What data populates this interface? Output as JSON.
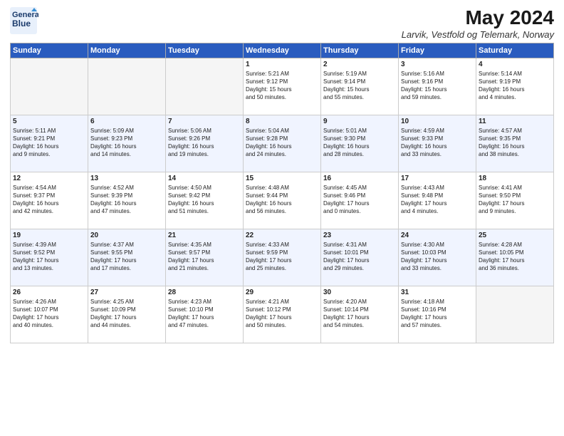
{
  "logo": {
    "line1": "General",
    "line2": "Blue"
  },
  "title": "May 2024",
  "location": "Larvik, Vestfold og Telemark, Norway",
  "days_of_week": [
    "Sunday",
    "Monday",
    "Tuesday",
    "Wednesday",
    "Thursday",
    "Friday",
    "Saturday"
  ],
  "weeks": [
    [
      {
        "day": "",
        "info": ""
      },
      {
        "day": "",
        "info": ""
      },
      {
        "day": "",
        "info": ""
      },
      {
        "day": "1",
        "info": "Sunrise: 5:21 AM\nSunset: 9:12 PM\nDaylight: 15 hours\nand 50 minutes."
      },
      {
        "day": "2",
        "info": "Sunrise: 5:19 AM\nSunset: 9:14 PM\nDaylight: 15 hours\nand 55 minutes."
      },
      {
        "day": "3",
        "info": "Sunrise: 5:16 AM\nSunset: 9:16 PM\nDaylight: 15 hours\nand 59 minutes."
      },
      {
        "day": "4",
        "info": "Sunrise: 5:14 AM\nSunset: 9:19 PM\nDaylight: 16 hours\nand 4 minutes."
      }
    ],
    [
      {
        "day": "5",
        "info": "Sunrise: 5:11 AM\nSunset: 9:21 PM\nDaylight: 16 hours\nand 9 minutes."
      },
      {
        "day": "6",
        "info": "Sunrise: 5:09 AM\nSunset: 9:23 PM\nDaylight: 16 hours\nand 14 minutes."
      },
      {
        "day": "7",
        "info": "Sunrise: 5:06 AM\nSunset: 9:26 PM\nDaylight: 16 hours\nand 19 minutes."
      },
      {
        "day": "8",
        "info": "Sunrise: 5:04 AM\nSunset: 9:28 PM\nDaylight: 16 hours\nand 24 minutes."
      },
      {
        "day": "9",
        "info": "Sunrise: 5:01 AM\nSunset: 9:30 PM\nDaylight: 16 hours\nand 28 minutes."
      },
      {
        "day": "10",
        "info": "Sunrise: 4:59 AM\nSunset: 9:33 PM\nDaylight: 16 hours\nand 33 minutes."
      },
      {
        "day": "11",
        "info": "Sunrise: 4:57 AM\nSunset: 9:35 PM\nDaylight: 16 hours\nand 38 minutes."
      }
    ],
    [
      {
        "day": "12",
        "info": "Sunrise: 4:54 AM\nSunset: 9:37 PM\nDaylight: 16 hours\nand 42 minutes."
      },
      {
        "day": "13",
        "info": "Sunrise: 4:52 AM\nSunset: 9:39 PM\nDaylight: 16 hours\nand 47 minutes."
      },
      {
        "day": "14",
        "info": "Sunrise: 4:50 AM\nSunset: 9:42 PM\nDaylight: 16 hours\nand 51 minutes."
      },
      {
        "day": "15",
        "info": "Sunrise: 4:48 AM\nSunset: 9:44 PM\nDaylight: 16 hours\nand 56 minutes."
      },
      {
        "day": "16",
        "info": "Sunrise: 4:45 AM\nSunset: 9:46 PM\nDaylight: 17 hours\nand 0 minutes."
      },
      {
        "day": "17",
        "info": "Sunrise: 4:43 AM\nSunset: 9:48 PM\nDaylight: 17 hours\nand 4 minutes."
      },
      {
        "day": "18",
        "info": "Sunrise: 4:41 AM\nSunset: 9:50 PM\nDaylight: 17 hours\nand 9 minutes."
      }
    ],
    [
      {
        "day": "19",
        "info": "Sunrise: 4:39 AM\nSunset: 9:52 PM\nDaylight: 17 hours\nand 13 minutes."
      },
      {
        "day": "20",
        "info": "Sunrise: 4:37 AM\nSunset: 9:55 PM\nDaylight: 17 hours\nand 17 minutes."
      },
      {
        "day": "21",
        "info": "Sunrise: 4:35 AM\nSunset: 9:57 PM\nDaylight: 17 hours\nand 21 minutes."
      },
      {
        "day": "22",
        "info": "Sunrise: 4:33 AM\nSunset: 9:59 PM\nDaylight: 17 hours\nand 25 minutes."
      },
      {
        "day": "23",
        "info": "Sunrise: 4:31 AM\nSunset: 10:01 PM\nDaylight: 17 hours\nand 29 minutes."
      },
      {
        "day": "24",
        "info": "Sunrise: 4:30 AM\nSunset: 10:03 PM\nDaylight: 17 hours\nand 33 minutes."
      },
      {
        "day": "25",
        "info": "Sunrise: 4:28 AM\nSunset: 10:05 PM\nDaylight: 17 hours\nand 36 minutes."
      }
    ],
    [
      {
        "day": "26",
        "info": "Sunrise: 4:26 AM\nSunset: 10:07 PM\nDaylight: 17 hours\nand 40 minutes."
      },
      {
        "day": "27",
        "info": "Sunrise: 4:25 AM\nSunset: 10:09 PM\nDaylight: 17 hours\nand 44 minutes."
      },
      {
        "day": "28",
        "info": "Sunrise: 4:23 AM\nSunset: 10:10 PM\nDaylight: 17 hours\nand 47 minutes."
      },
      {
        "day": "29",
        "info": "Sunrise: 4:21 AM\nSunset: 10:12 PM\nDaylight: 17 hours\nand 50 minutes."
      },
      {
        "day": "30",
        "info": "Sunrise: 4:20 AM\nSunset: 10:14 PM\nDaylight: 17 hours\nand 54 minutes."
      },
      {
        "day": "31",
        "info": "Sunrise: 4:18 AM\nSunset: 10:16 PM\nDaylight: 17 hours\nand 57 minutes."
      },
      {
        "day": "",
        "info": ""
      }
    ]
  ]
}
